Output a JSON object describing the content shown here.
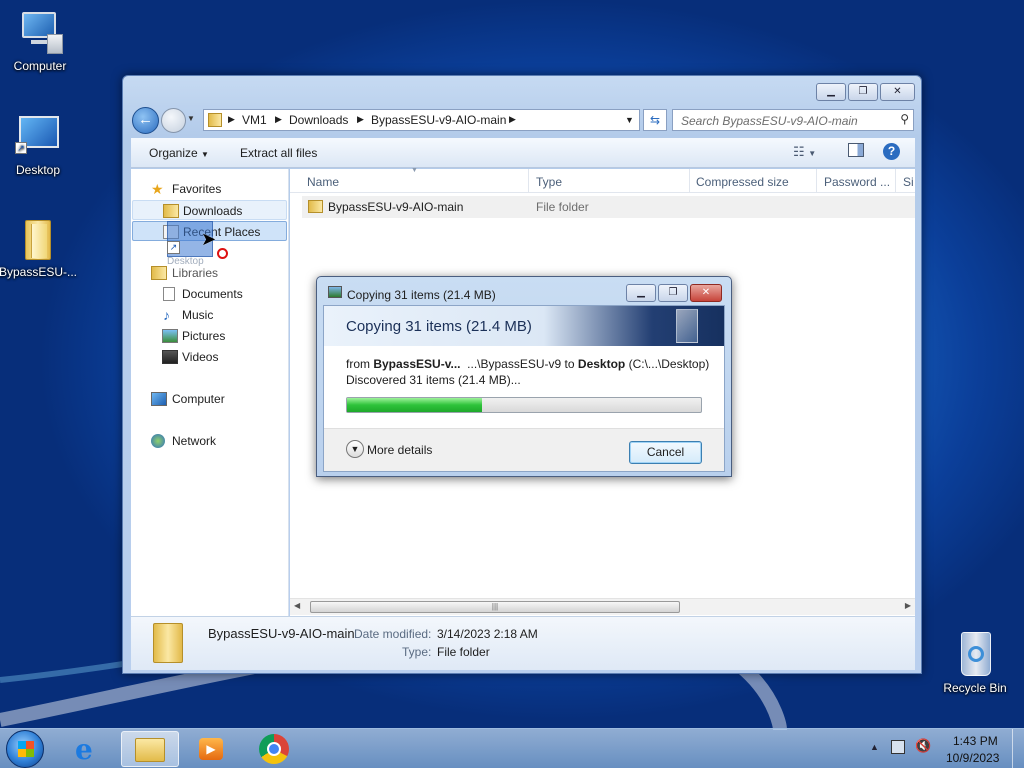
{
  "desktop": {
    "icons": [
      {
        "label": "Computer"
      },
      {
        "label": "Desktop"
      },
      {
        "label": "BypassESU-..."
      },
      {
        "label": "Recycle Bin"
      }
    ]
  },
  "explorer": {
    "breadcrumb": [
      "VM1",
      "Downloads",
      "BypassESU-v9-AIO-main"
    ],
    "search_placeholder": "Search BypassESU-v9-AIO-main",
    "toolbar": {
      "organize": "Organize",
      "extract": "Extract all files"
    },
    "nav": {
      "favorites": "Favorites",
      "downloads": "Downloads",
      "recent": "Recent Places",
      "libraries": "Libraries",
      "documents": "Documents",
      "music": "Music",
      "pictures": "Pictures",
      "videos": "Videos",
      "computer": "Computer",
      "network": "Network",
      "drag_ghost": "Desktop"
    },
    "columns": [
      "Name",
      "Type",
      "Compressed size",
      "Password ...",
      "Si"
    ],
    "rows": [
      {
        "name": "BypassESU-v9-AIO-main",
        "type": "File folder"
      }
    ],
    "details": {
      "name": "BypassESU-v9-AIO-main",
      "modified_label": "Date modified:",
      "modified_value": "3/14/2023 2:18 AM",
      "type_label": "Type:",
      "type_value": "File folder"
    }
  },
  "dialog": {
    "title": "Copying 31 items (21.4 MB)",
    "heading": "Copying 31 items (21.4 MB)",
    "from_word": "from",
    "from_name": "BypassESU-v...",
    "from_path": "...\\BypassESU-v9",
    "to_word": "to",
    "to_name": "Desktop",
    "to_path": "(C:\\...\\Desktop)",
    "discovered": "Discovered 31 items (21.4 MB)...",
    "progress_fraction": 0.38,
    "more_details": "More details",
    "cancel": "Cancel"
  },
  "taskbar": {
    "time": "1:43 PM",
    "date": "10/9/2023"
  },
  "colors": {
    "accent": "#1d6fcf",
    "progress_green": "#2ec33a",
    "close_red": "#c7443a"
  }
}
